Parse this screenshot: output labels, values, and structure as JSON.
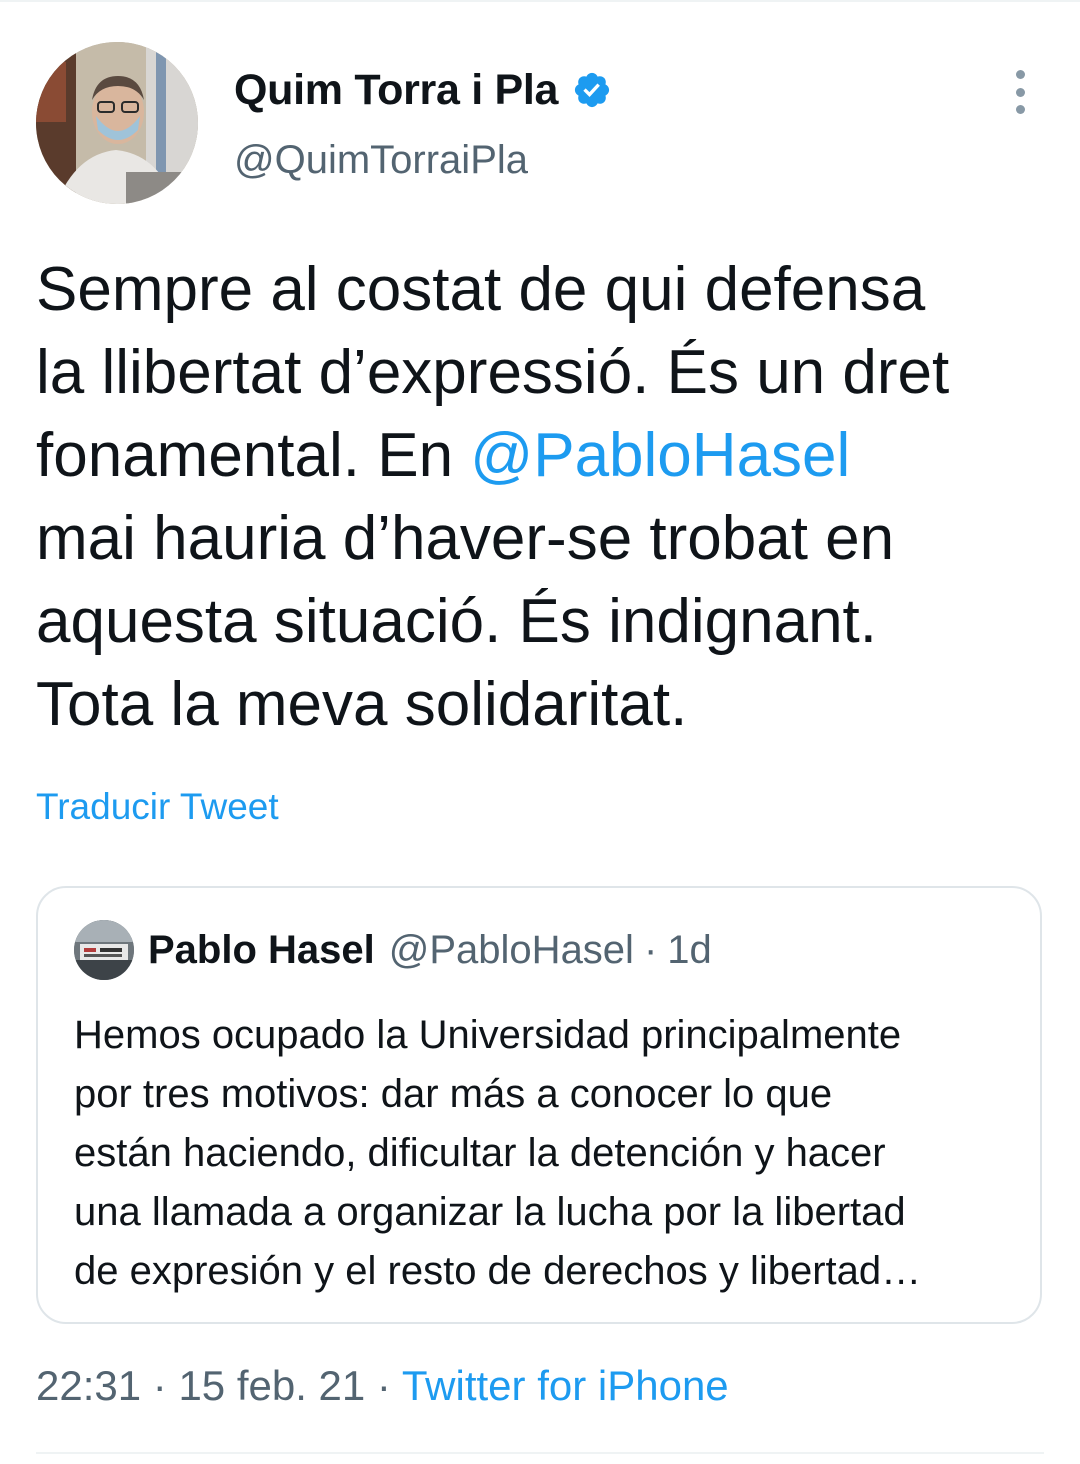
{
  "author": {
    "display_name": "Quim Torra i Pla",
    "handle": "@QuimTorraiPla",
    "verified_icon": "verified-badge-icon",
    "avatar_icon": "person-portrait-masked",
    "more_icon": "more-vertical-icon"
  },
  "tweet": {
    "lines": [
      "Sempre al costat de qui defensa",
      "la llibertat d’expressió. És un dret",
      "fonamental. En ",
      "mai hauria d’haver-se trobat en",
      "aquesta situació. És indignant.",
      "Tota la meva solidaritat."
    ],
    "mention": "@PabloHasel",
    "translate_label": "Traducir Tweet"
  },
  "quoted": {
    "display_name": "Pablo Hasel",
    "handle": "@PabloHasel",
    "separator": "·",
    "time": "1d",
    "lines": [
      "Hemos ocupado la Universidad principalmente",
      "por tres motivos: dar más a conocer lo que",
      "están haciendo, dificultar la detención y hacer",
      "una llamada a organizar la lucha por la libertad",
      "de expresión y el resto de derechos y libertad…"
    ]
  },
  "meta": {
    "time": "22:31",
    "sep1": " · ",
    "date": "15 feb. 21",
    "sep2": " · ",
    "source": "Twitter for iPhone"
  },
  "colors": {
    "link": "#1d9bf0",
    "text": "#0f1419",
    "secondary": "#536471",
    "border": "#dfe5e9"
  }
}
